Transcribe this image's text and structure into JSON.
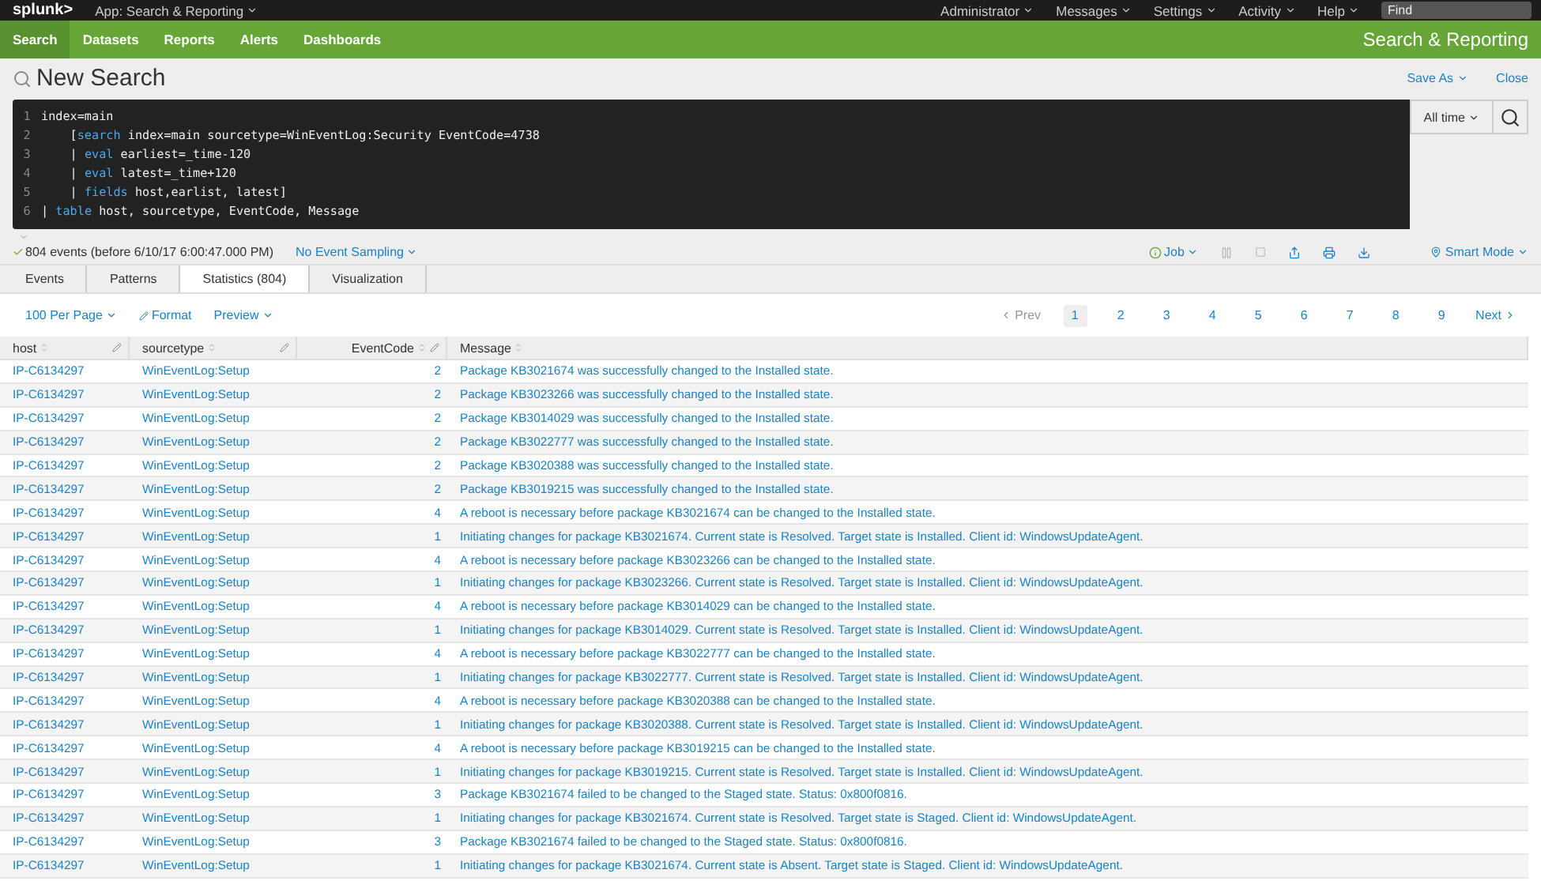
{
  "top_bar": {
    "logo": "splunk>",
    "app_menu": "App: Search & Reporting",
    "menus": [
      "Administrator",
      "Messages",
      "Settings",
      "Activity",
      "Help"
    ],
    "find_placeholder": "Find"
  },
  "nav": {
    "items": [
      {
        "label": "Search",
        "selected": true
      },
      {
        "label": "Datasets",
        "selected": false
      },
      {
        "label": "Reports",
        "selected": false
      },
      {
        "label": "Alerts",
        "selected": false
      },
      {
        "label": "Dashboards",
        "selected": false
      }
    ],
    "app_title": "Search & Reporting"
  },
  "title_bar": {
    "title": "New Search",
    "save_as": "Save As",
    "close": "Close"
  },
  "editor": {
    "lines": [
      [
        {
          "kind": "plain",
          "text": "index=main"
        }
      ],
      [
        {
          "kind": "plain",
          "text": "    ["
        },
        {
          "kind": "keyword",
          "text": "search"
        },
        {
          "kind": "plain",
          "text": " index=main sourcetype=WinEventLog:Security EventCode=4738"
        }
      ],
      [
        {
          "kind": "plain",
          "text": "    | "
        },
        {
          "kind": "keyword",
          "text": "eval"
        },
        {
          "kind": "plain",
          "text": " earliest=_time-120"
        }
      ],
      [
        {
          "kind": "plain",
          "text": "    | "
        },
        {
          "kind": "keyword",
          "text": "eval"
        },
        {
          "kind": "plain",
          "text": " latest=_time+120"
        }
      ],
      [
        {
          "kind": "plain",
          "text": "    | "
        },
        {
          "kind": "keyword",
          "text": "fields"
        },
        {
          "kind": "plain",
          "text": " host,earlist, latest]"
        }
      ],
      [
        {
          "kind": "plain",
          "text": "| "
        },
        {
          "kind": "keyword",
          "text": "table"
        },
        {
          "kind": "plain",
          "text": " host, sourcetype, EventCode, Message"
        }
      ]
    ],
    "line_numbers": [
      "1",
      "2",
      "3",
      "4",
      "5",
      "6"
    ],
    "time_range": "All time"
  },
  "status": {
    "summary": "804 events (before 6/10/17 6:00:47.000 PM)",
    "sampling": "No Event Sampling",
    "job": "Job",
    "mode": "Smart Mode"
  },
  "tabs": [
    {
      "label": "Events",
      "selected": false
    },
    {
      "label": "Patterns",
      "selected": false
    },
    {
      "label": "Statistics (804)",
      "selected": true
    },
    {
      "label": "Visualization",
      "selected": false
    }
  ],
  "controls": {
    "per_page": "100 Per Page",
    "format": "Format",
    "preview": "Preview"
  },
  "pagination": {
    "prev": "Prev",
    "prev_disabled": true,
    "pages": [
      {
        "label": "1",
        "selected": true
      },
      {
        "label": "2",
        "selected": false
      },
      {
        "label": "3",
        "selected": false
      },
      {
        "label": "4",
        "selected": false
      },
      {
        "label": "5",
        "selected": false
      },
      {
        "label": "6",
        "selected": false
      },
      {
        "label": "7",
        "selected": false
      },
      {
        "label": "8",
        "selected": false
      },
      {
        "label": "9",
        "selected": false
      }
    ],
    "next": "Next"
  },
  "table": {
    "columns": [
      {
        "label": "host",
        "kind": "text",
        "editable": true
      },
      {
        "label": "sourcetype",
        "kind": "text",
        "editable": true
      },
      {
        "label": "EventCode",
        "kind": "number",
        "editable": true
      },
      {
        "label": "Message",
        "kind": "text",
        "editable": false
      }
    ],
    "rows": [
      [
        "IP-C6134297",
        "WinEventLog:Setup",
        "2",
        "Package KB3021674 was successfully changed to the Installed state."
      ],
      [
        "IP-C6134297",
        "WinEventLog:Setup",
        "2",
        "Package KB3023266 was successfully changed to the Installed state."
      ],
      [
        "IP-C6134297",
        "WinEventLog:Setup",
        "2",
        "Package KB3014029 was successfully changed to the Installed state."
      ],
      [
        "IP-C6134297",
        "WinEventLog:Setup",
        "2",
        "Package KB3022777 was successfully changed to the Installed state."
      ],
      [
        "IP-C6134297",
        "WinEventLog:Setup",
        "2",
        "Package KB3020388 was successfully changed to the Installed state."
      ],
      [
        "IP-C6134297",
        "WinEventLog:Setup",
        "2",
        "Package KB3019215 was successfully changed to the Installed state."
      ],
      [
        "IP-C6134297",
        "WinEventLog:Setup",
        "4",
        "A reboot is necessary before package KB3021674 can be changed to the Installed state."
      ],
      [
        "IP-C6134297",
        "WinEventLog:Setup",
        "1",
        "Initiating changes for package KB3021674. Current state is Resolved. Target state is Installed. Client id: WindowsUpdateAgent."
      ],
      [
        "IP-C6134297",
        "WinEventLog:Setup",
        "4",
        "A reboot is necessary before package KB3023266 can be changed to the Installed state."
      ],
      [
        "IP-C6134297",
        "WinEventLog:Setup",
        "1",
        "Initiating changes for package KB3023266. Current state is Resolved. Target state is Installed. Client id: WindowsUpdateAgent."
      ],
      [
        "IP-C6134297",
        "WinEventLog:Setup",
        "4",
        "A reboot is necessary before package KB3014029 can be changed to the Installed state."
      ],
      [
        "IP-C6134297",
        "WinEventLog:Setup",
        "1",
        "Initiating changes for package KB3014029. Current state is Resolved. Target state is Installed. Client id: WindowsUpdateAgent."
      ],
      [
        "IP-C6134297",
        "WinEventLog:Setup",
        "4",
        "A reboot is necessary before package KB3022777 can be changed to the Installed state."
      ],
      [
        "IP-C6134297",
        "WinEventLog:Setup",
        "1",
        "Initiating changes for package KB3022777. Current state is Resolved. Target state is Installed. Client id: WindowsUpdateAgent."
      ],
      [
        "IP-C6134297",
        "WinEventLog:Setup",
        "4",
        "A reboot is necessary before package KB3020388 can be changed to the Installed state."
      ],
      [
        "IP-C6134297",
        "WinEventLog:Setup",
        "1",
        "Initiating changes for package KB3020388. Current state is Resolved. Target state is Installed. Client id: WindowsUpdateAgent."
      ],
      [
        "IP-C6134297",
        "WinEventLog:Setup",
        "4",
        "A reboot is necessary before package KB3019215 can be changed to the Installed state."
      ],
      [
        "IP-C6134297",
        "WinEventLog:Setup",
        "1",
        "Initiating changes for package KB3019215. Current state is Resolved. Target state is Installed. Client id: WindowsUpdateAgent."
      ],
      [
        "IP-C6134297",
        "WinEventLog:Setup",
        "3",
        "Package KB3021674 failed to be changed to the Staged state. Status: 0x800f0816."
      ],
      [
        "IP-C6134297",
        "WinEventLog:Setup",
        "1",
        "Initiating changes for package KB3021674. Current state is Resolved. Target state is Staged. Client id: WindowsUpdateAgent."
      ],
      [
        "IP-C6134297",
        "WinEventLog:Setup",
        "3",
        "Package KB3021674 failed to be changed to the Staged state. Status: 0x800f0816."
      ],
      [
        "IP-C6134297",
        "WinEventLog:Setup",
        "1",
        "Initiating changes for package KB3021674. Current state is Absent. Target state is Staged. Client id: WindowsUpdateAgent."
      ]
    ]
  }
}
